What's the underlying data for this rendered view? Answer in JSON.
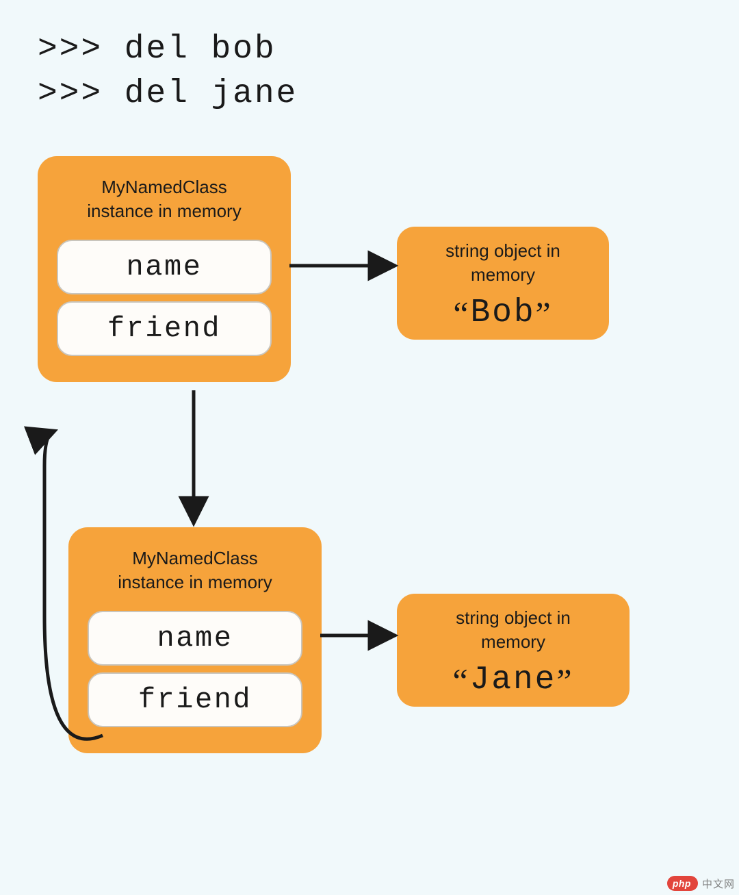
{
  "code": {
    "line1": ">>> del bob",
    "line2": ">>> del jane"
  },
  "instance1": {
    "header_line1": "MyNamedClass",
    "header_line2": "instance in memory",
    "attr1": "name",
    "attr2": "friend"
  },
  "instance2": {
    "header_line1": "MyNamedClass",
    "header_line2": "instance in memory",
    "attr1": "name",
    "attr2": "friend"
  },
  "string1": {
    "label_line1": "string object in",
    "label_line2": "memory",
    "value": "Bob"
  },
  "string2": {
    "label_line1": "string object in",
    "label_line2": "memory",
    "value": "Jane"
  },
  "colors": {
    "bg": "#f1f9fb",
    "box": "#f6a33b",
    "attr_bg": "#fefcf9",
    "attr_border": "#c9c5bd",
    "text": "#1a1a1a"
  },
  "watermark": {
    "pill": "php",
    "text": "中文网"
  }
}
